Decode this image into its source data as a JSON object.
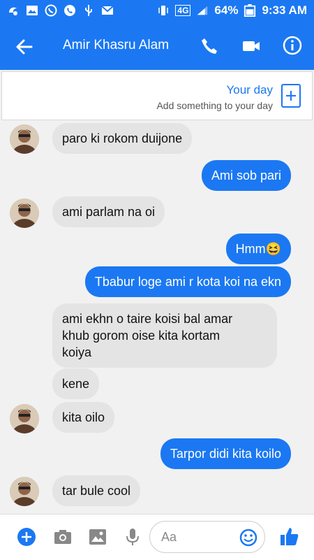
{
  "status": {
    "network": "4G",
    "battery": "64%",
    "time": "9:33 AM"
  },
  "header": {
    "title": "Amir Khasru Alam"
  },
  "your_day": {
    "title": "Your day",
    "subtitle": "Add something to your day"
  },
  "messages": [
    {
      "dir": "in",
      "text": "paro ki rokom duijone"
    },
    {
      "dir": "out",
      "text": "Ami sob pari"
    },
    {
      "dir": "in",
      "text": "ami parlam na oi"
    },
    {
      "dir": "out",
      "text": "Hmm😆"
    },
    {
      "dir": "out",
      "text": "Tbabur loge ami r kota koi na ekn"
    },
    {
      "dir": "in",
      "text_lines": [
        "ami ekhn o taire koisi bal amar",
        "khub gorom oise kita kortam",
        "koiya"
      ]
    },
    {
      "dir": "in",
      "text": "kene"
    },
    {
      "dir": "in",
      "text": "kita oilo"
    },
    {
      "dir": "out",
      "text": "Tarpor didi kita koilo"
    },
    {
      "dir": "in",
      "text": "tar bule cool"
    }
  ],
  "composer": {
    "placeholder": "Aa"
  },
  "colors": {
    "accent": "#1b78f2",
    "incoming_bubble": "#e4e4e4"
  },
  "icons": [
    "back-arrow-icon",
    "phone-icon",
    "video-icon",
    "info-icon",
    "plus-icon",
    "camera-icon",
    "image-icon",
    "mic-icon",
    "emoji-icon",
    "like-icon"
  ]
}
